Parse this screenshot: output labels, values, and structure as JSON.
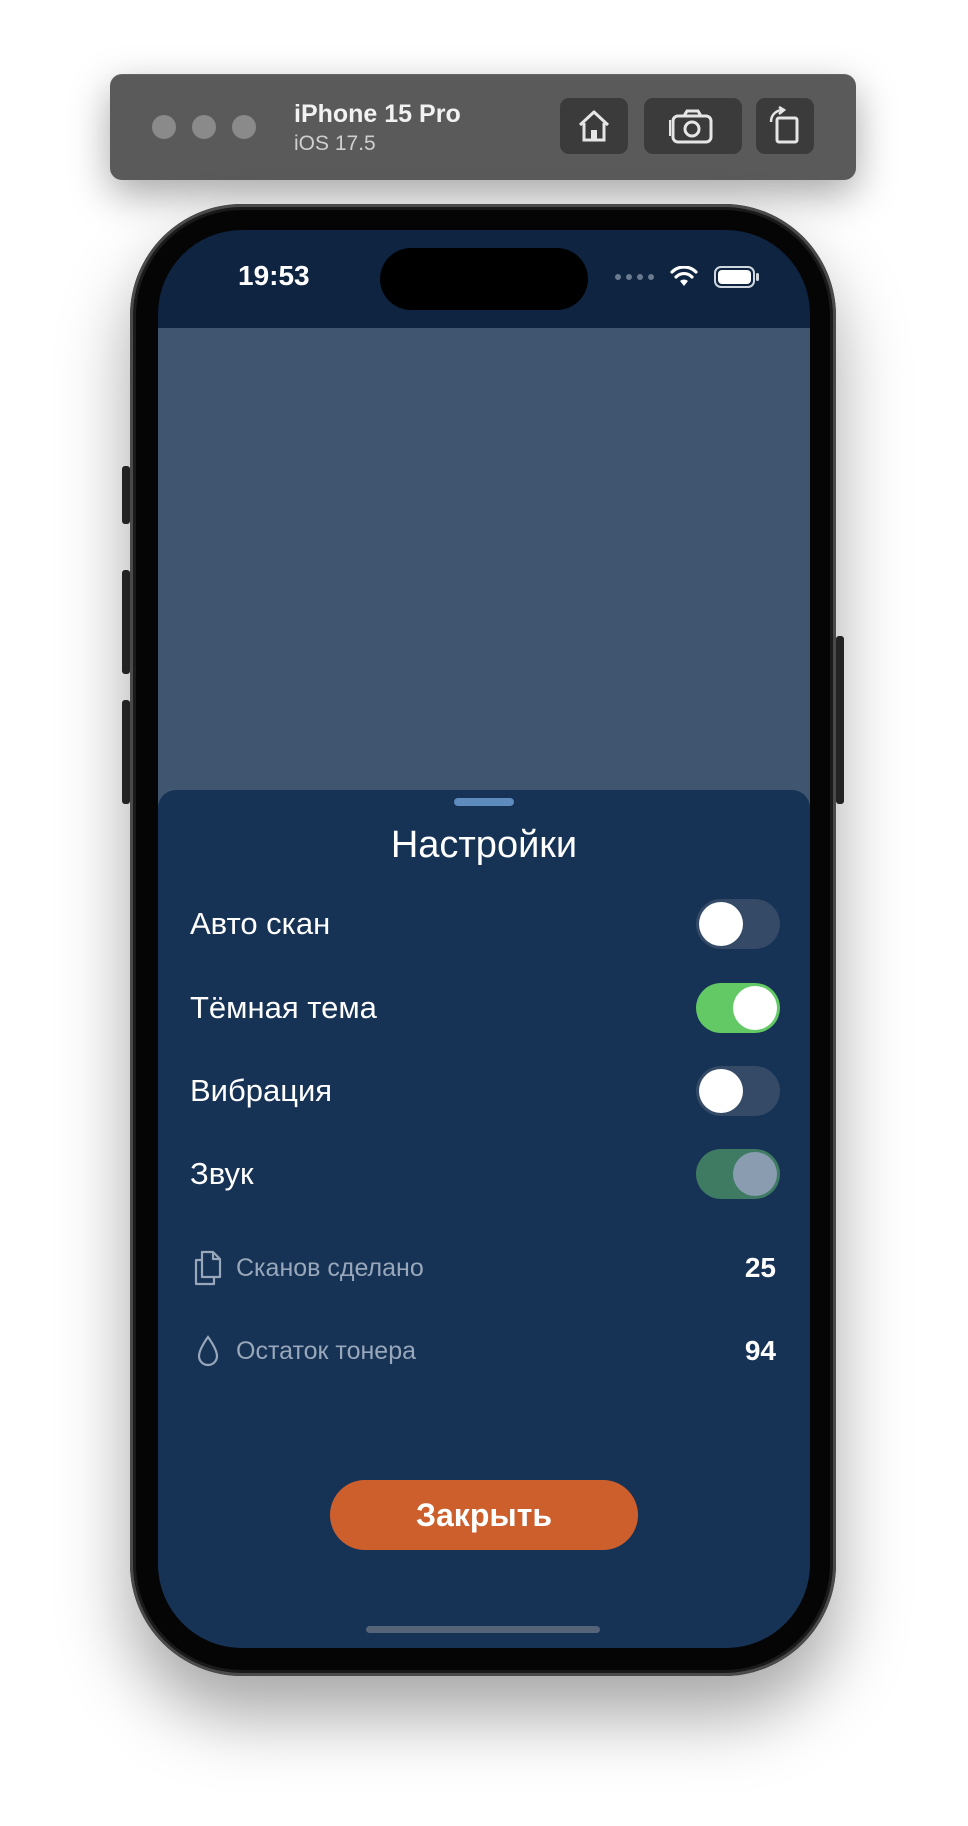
{
  "simulator": {
    "device": "iPhone 15 Pro",
    "os": "iOS 17.5"
  },
  "status_bar": {
    "time": "19:53"
  },
  "sheet": {
    "title": "Настройки",
    "toggles": [
      {
        "label": "Авто скан",
        "state": "off"
      },
      {
        "label": "Тёмная тема",
        "state": "on"
      },
      {
        "label": "Вибрация",
        "state": "off"
      },
      {
        "label": "Звук",
        "state": "on-disabled"
      }
    ],
    "stats": [
      {
        "icon": "documents-icon",
        "label": "Сканов сделано",
        "value": "25"
      },
      {
        "icon": "drop-icon",
        "label": "Остаток тонера",
        "value": "94"
      }
    ],
    "close_label": "Закрыть"
  },
  "colors": {
    "sheet_bg": "#163255",
    "backdrop": "#40556f",
    "toggle_on": "#62c964",
    "accent_button": "#cd5f2c"
  }
}
